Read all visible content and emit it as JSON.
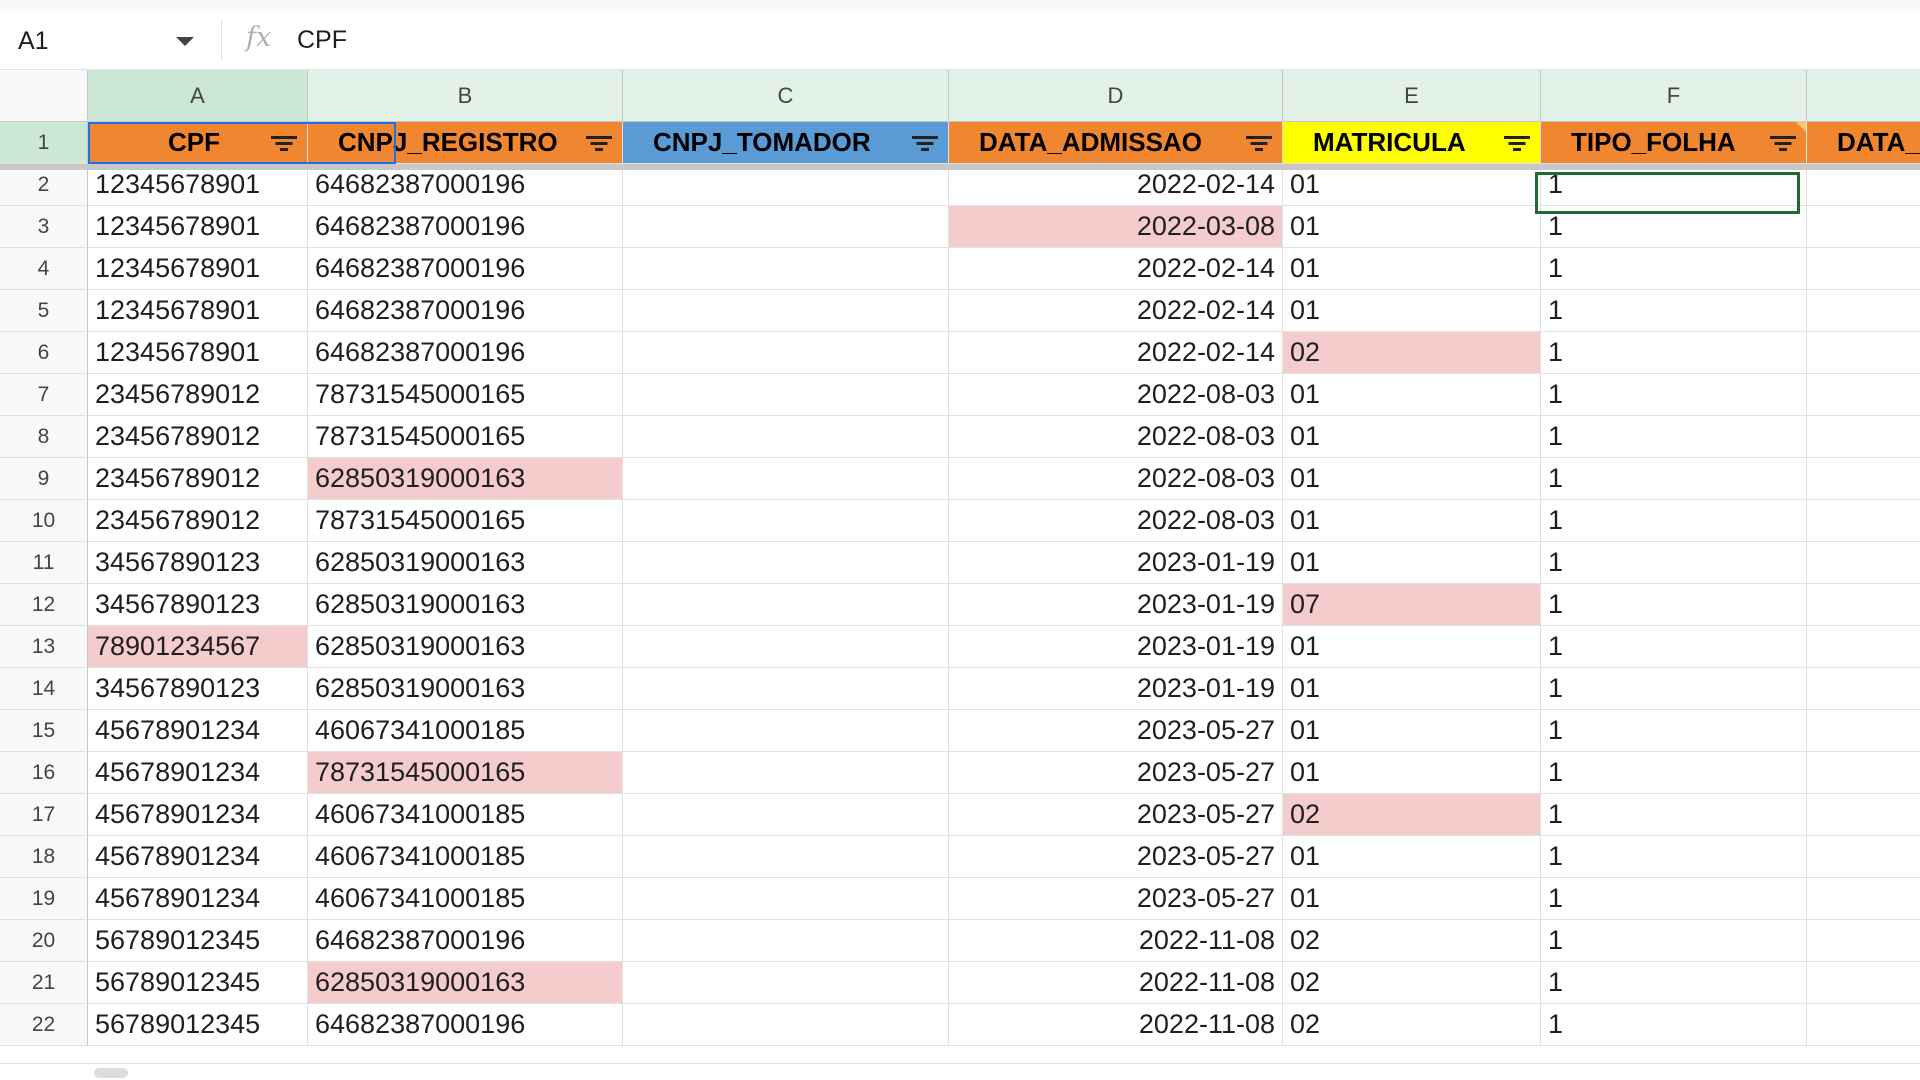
{
  "formula_bar": {
    "cell_ref": "A1",
    "content": "CPF",
    "fx": "fx"
  },
  "columns": [
    "A",
    "B",
    "C",
    "D",
    "E",
    "F"
  ],
  "headers": [
    "CPF",
    "CNPJ_REGISTRO",
    "CNPJ_TOMADOR",
    "DATA_ADMISSAO",
    "MATRICULA",
    "TIPO_FOLHA",
    "DATA_"
  ],
  "header_colors": {
    "orange": "#f18630",
    "blue": "#5b9bd5",
    "yellow": "#ffff00",
    "highlight": "#f4cccc"
  },
  "rows": [
    {
      "n": "2",
      "cpf": "12345678901",
      "cnpj": "64682387000196",
      "tomador": "",
      "data": "2022-02-14",
      "mat": "01",
      "tipo": "1"
    },
    {
      "n": "3",
      "cpf": "12345678901",
      "cnpj": "64682387000196",
      "tomador": "",
      "data": "2022-03-08",
      "mat": "01",
      "tipo": "1"
    },
    {
      "n": "4",
      "cpf": "12345678901",
      "cnpj": "64682387000196",
      "tomador": "",
      "data": "2022-02-14",
      "mat": "01",
      "tipo": "1"
    },
    {
      "n": "5",
      "cpf": "12345678901",
      "cnpj": "64682387000196",
      "tomador": "",
      "data": "2022-02-14",
      "mat": "01",
      "tipo": "1"
    },
    {
      "n": "6",
      "cpf": "12345678901",
      "cnpj": "64682387000196",
      "tomador": "",
      "data": "2022-02-14",
      "mat": "02",
      "tipo": "1"
    },
    {
      "n": "7",
      "cpf": "23456789012",
      "cnpj": "78731545000165",
      "tomador": "",
      "data": "2022-08-03",
      "mat": "01",
      "tipo": "1"
    },
    {
      "n": "8",
      "cpf": "23456789012",
      "cnpj": "78731545000165",
      "tomador": "",
      "data": "2022-08-03",
      "mat": "01",
      "tipo": "1"
    },
    {
      "n": "9",
      "cpf": "23456789012",
      "cnpj": "62850319000163",
      "tomador": "",
      "data": "2022-08-03",
      "mat": "01",
      "tipo": "1"
    },
    {
      "n": "10",
      "cpf": "23456789012",
      "cnpj": "78731545000165",
      "tomador": "",
      "data": "2022-08-03",
      "mat": "01",
      "tipo": "1"
    },
    {
      "n": "11",
      "cpf": "34567890123",
      "cnpj": "62850319000163",
      "tomador": "",
      "data": "2023-01-19",
      "mat": "01",
      "tipo": "1"
    },
    {
      "n": "12",
      "cpf": "34567890123",
      "cnpj": "62850319000163",
      "tomador": "",
      "data": "2023-01-19",
      "mat": "07",
      "tipo": "1"
    },
    {
      "n": "13",
      "cpf": "78901234567",
      "cnpj": "62850319000163",
      "tomador": "",
      "data": "2023-01-19",
      "mat": "01",
      "tipo": "1"
    },
    {
      "n": "14",
      "cpf": "34567890123",
      "cnpj": "62850319000163",
      "tomador": "",
      "data": "2023-01-19",
      "mat": "01",
      "tipo": "1"
    },
    {
      "n": "15",
      "cpf": "45678901234",
      "cnpj": "46067341000185",
      "tomador": "",
      "data": "2023-05-27",
      "mat": "01",
      "tipo": "1"
    },
    {
      "n": "16",
      "cpf": "45678901234",
      "cnpj": "78731545000165",
      "tomador": "",
      "data": "2023-05-27",
      "mat": "01",
      "tipo": "1"
    },
    {
      "n": "17",
      "cpf": "45678901234",
      "cnpj": "46067341000185",
      "tomador": "",
      "data": "2023-05-27",
      "mat": "02",
      "tipo": "1"
    },
    {
      "n": "18",
      "cpf": "45678901234",
      "cnpj": "46067341000185",
      "tomador": "",
      "data": "2023-05-27",
      "mat": "01",
      "tipo": "1"
    },
    {
      "n": "19",
      "cpf": "45678901234",
      "cnpj": "46067341000185",
      "tomador": "",
      "data": "2023-05-27",
      "mat": "01",
      "tipo": "1"
    },
    {
      "n": "20",
      "cpf": "56789012345",
      "cnpj": "64682387000196",
      "tomador": "",
      "data": "2022-11-08",
      "mat": "02",
      "tipo": "1"
    },
    {
      "n": "21",
      "cpf": "56789012345",
      "cnpj": "62850319000163",
      "tomador": "",
      "data": "2022-11-08",
      "mat": "02",
      "tipo": "1"
    },
    {
      "n": "22",
      "cpf": "56789012345",
      "cnpj": "64682387000196",
      "tomador": "",
      "data": "2022-11-08",
      "mat": "02",
      "tipo": "1"
    }
  ],
  "highlighted": [
    [
      3,
      "data"
    ],
    [
      6,
      "mat"
    ],
    [
      9,
      "cnpj"
    ],
    [
      12,
      "mat"
    ],
    [
      13,
      "cpf"
    ],
    [
      16,
      "cnpj"
    ],
    [
      17,
      "mat"
    ],
    [
      21,
      "cnpj"
    ]
  ]
}
